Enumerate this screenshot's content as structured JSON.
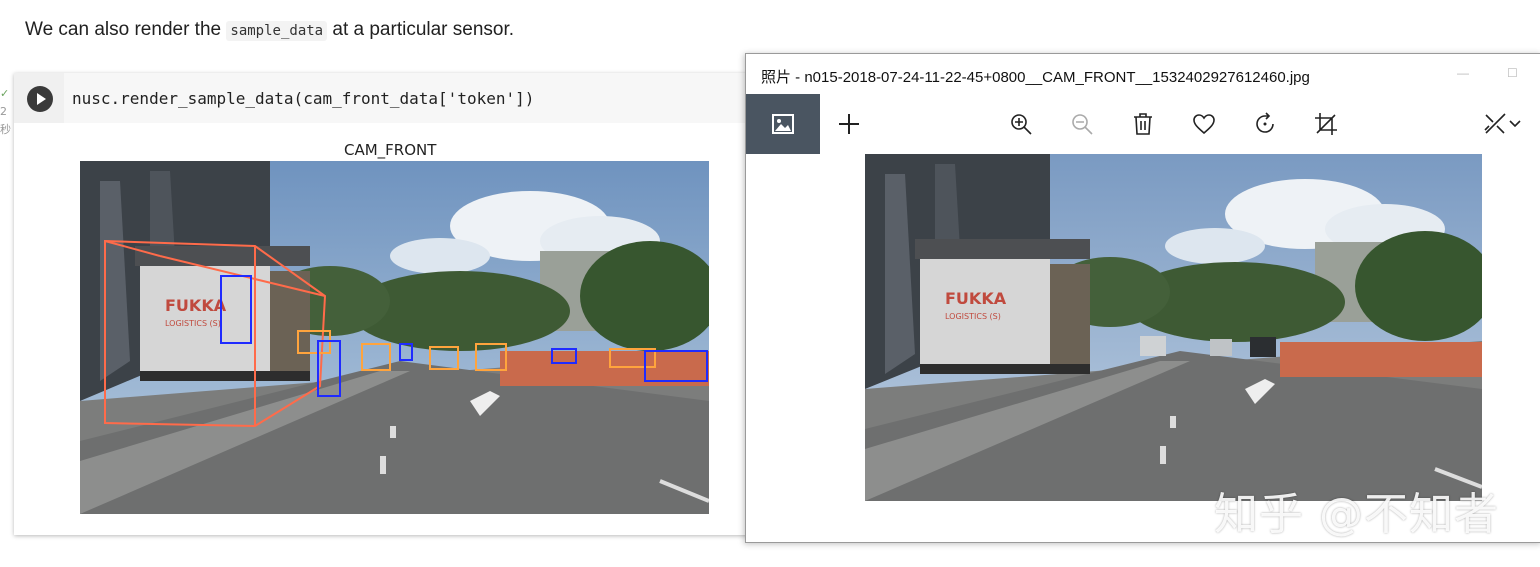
{
  "intro": {
    "before": "We can also render the",
    "code": "sample_data",
    "after": "at a particular sensor."
  },
  "cell": {
    "code": "nusc.render_sample_data(cam_front_data['token'])",
    "output_title": "CAM_FRONT",
    "gutter_marks": [
      "✓",
      "2",
      "秒"
    ]
  },
  "viewer": {
    "title": "照片 - n015-2018-07-24-11-22-45+0800__CAM_FRONT__1532402927612460.jpg",
    "toolbar": [
      {
        "name": "image-icon",
        "active": true
      },
      {
        "name": "add-icon"
      },
      {
        "name": "zoom-in-icon"
      },
      {
        "name": "zoom-out-icon"
      },
      {
        "name": "delete-icon"
      },
      {
        "name": "favorite-icon"
      },
      {
        "name": "rotate-icon"
      },
      {
        "name": "crop-icon"
      },
      {
        "name": "edit-icon"
      },
      {
        "name": "chevron-down-icon"
      }
    ]
  },
  "scene": {
    "truck_sign": "FUKKA",
    "truck_sub": "LOGISTICS (S)"
  },
  "watermark": "知乎 @不知者"
}
